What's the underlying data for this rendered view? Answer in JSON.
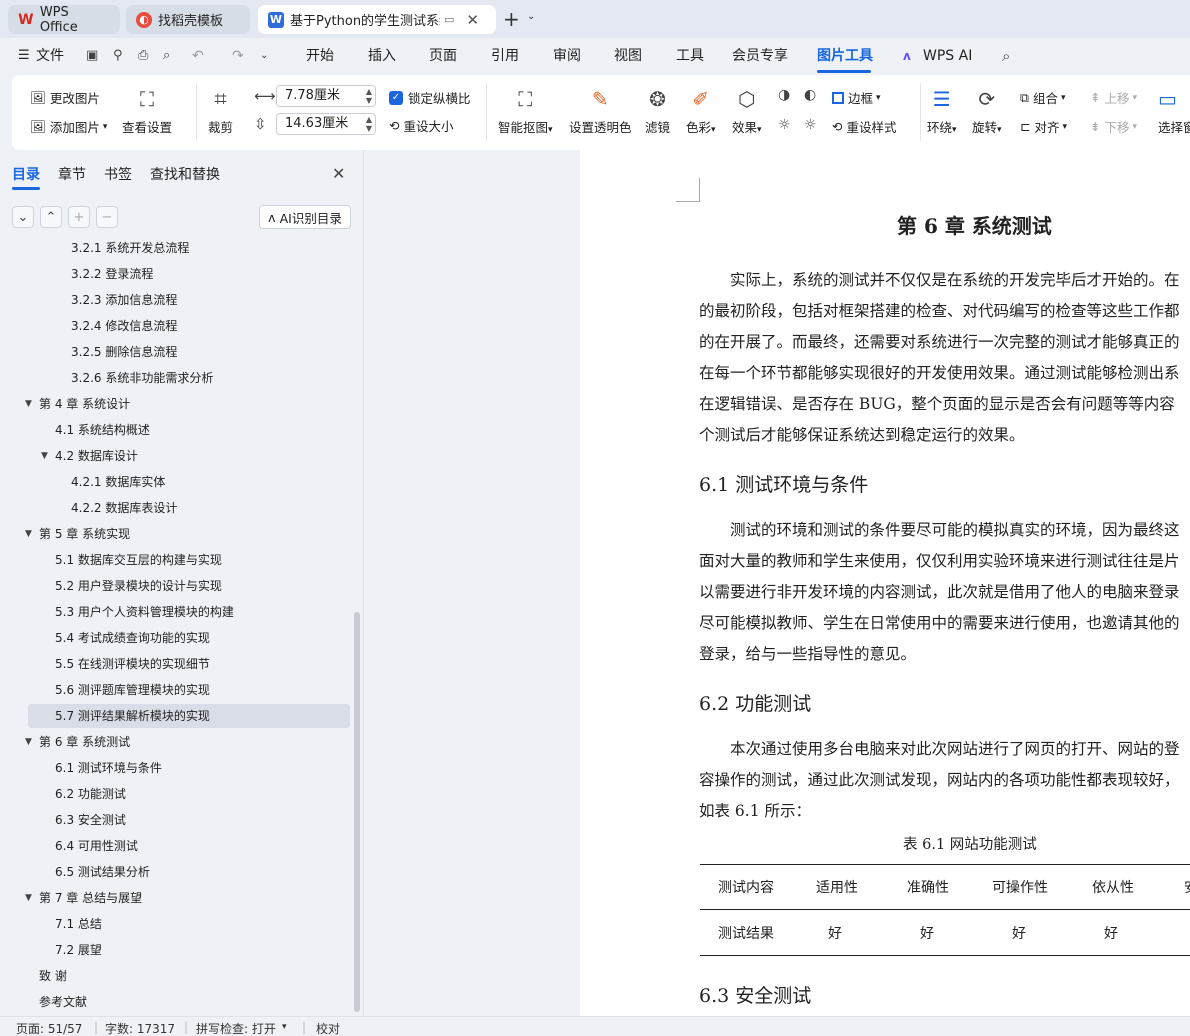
{
  "tabs": [
    {
      "label": "WPS Office",
      "icon": "wps-logo-icon"
    },
    {
      "label": "找稻壳模板",
      "icon": "docer-icon"
    },
    {
      "label": "基于Python的学生测试系统",
      "icon": "writer-doc-icon"
    }
  ],
  "menu": {
    "file": "文件",
    "items": [
      "开始",
      "插入",
      "页面",
      "引用",
      "审阅",
      "视图",
      "工具",
      "会员专享",
      "图片工具",
      "WPS AI"
    ],
    "active": "图片工具"
  },
  "ribbon": {
    "change_picture": "更改图片",
    "add_picture": "添加图片",
    "view_settings": "查看设置",
    "crop": "裁剪",
    "width": "7.78厘米",
    "height": "14.63厘米",
    "lock_ratio": "锁定纵横比",
    "reset_size": "重设大小",
    "smart_cutout": "智能抠图",
    "set_transparent": "设置透明色",
    "filter": "滤镜",
    "color": "色彩",
    "effects": "效果",
    "border": "边框",
    "reset_style": "重设样式",
    "wrap": "环绕",
    "rotate": "旋转",
    "group": "组合",
    "align": "对齐",
    "bring_forward": "上移",
    "send_backward": "下移",
    "select_pane": "选择窗"
  },
  "sidebar": {
    "tabs": [
      "目录",
      "章节",
      "书签",
      "查找和替换"
    ],
    "ai_toc": "AI识别目录",
    "toc": [
      {
        "text": "3.2.1  系统开发总流程",
        "level": 3
      },
      {
        "text": "3.2.2  登录流程",
        "level": 3
      },
      {
        "text": "3.2.3  添加信息流程",
        "level": 3
      },
      {
        "text": "3.2.4  修改信息流程",
        "level": 3
      },
      {
        "text": "3.2.5  删除信息流程",
        "level": 3
      },
      {
        "text": "3.2.6 系统非功能需求分析",
        "level": 3
      },
      {
        "text": "第 4 章  系统设计",
        "level": 1,
        "expanded": true
      },
      {
        "text": "4.1  系统结构概述",
        "level": 2
      },
      {
        "text": "4.2  数据库设计",
        "level": 2,
        "expanded": true
      },
      {
        "text": "4.2.1  数据库实体",
        "level": 3
      },
      {
        "text": "4.2.2  数据库表设计",
        "level": 3
      },
      {
        "text": "第 5 章  系统实现",
        "level": 1,
        "expanded": true
      },
      {
        "text": "5.1  数据库交互层的构建与实现",
        "level": 2
      },
      {
        "text": "5.2  用户登录模块的设计与实现",
        "level": 2
      },
      {
        "text": "5.3  用户个人资料管理模块的构建",
        "level": 2
      },
      {
        "text": "5.4  考试成绩查询功能的实现",
        "level": 2
      },
      {
        "text": "5.5  在线测评模块的实现细节",
        "level": 2
      },
      {
        "text": "5.6  测评题库管理模块的实现",
        "level": 2
      },
      {
        "text": "5.7  测评结果解析模块的实现",
        "level": 2,
        "selected": true
      },
      {
        "text": "第 6 章  系统测试",
        "level": 1,
        "expanded": true
      },
      {
        "text": "6.1 测试环境与条件",
        "level": 2
      },
      {
        "text": "6.2 功能测试",
        "level": 2
      },
      {
        "text": "6.3 安全测试",
        "level": 2
      },
      {
        "text": "6.4 可用性测试",
        "level": 2
      },
      {
        "text": "6.5 测试结果分析",
        "level": 2
      },
      {
        "text": "第 7 章  总结与展望",
        "level": 1,
        "expanded": true
      },
      {
        "text": "7.1  总结",
        "level": 2
      },
      {
        "text": "7.2 展望",
        "level": 2
      },
      {
        "text": "致    谢",
        "level": 1
      },
      {
        "text": "参考文献",
        "level": 1
      }
    ]
  },
  "document": {
    "chapter_title": "第 6 章  系统测试",
    "intro": [
      "实际上，系统的测试并不仅仅是在系统的开发完毕后才开始的。在",
      "的最初阶段，包括对框架搭建的检查、对代码编写的检查等这些工作都",
      "的在开展了。而最终，还需要对系统进行一次完整的测试才能够真正的",
      "在每一个环节都能够实现很好的开发使用效果。通过测试能够检测出系",
      "在逻辑错误、是否存在 BUG，整个页面的显示是否会有问题等等内容",
      "个测试后才能够保证系统达到稳定运行的效果。"
    ],
    "s61_title": "6.1 测试环境与条件",
    "s61": [
      "测试的环境和测试的条件要尽可能的模拟真实的环境，因为最终这",
      "面对大量的教师和学生来使用，仅仅利用实验环境来进行测试往往是片",
      "以需要进行非开发环境的内容测试，此次就是借用了他人的电脑来登录",
      "尽可能模拟教师、学生在日常使用中的需要来进行使用，也邀请其他的",
      "登录，给与一些指导性的意见。"
    ],
    "s62_title": "6.2 功能测试",
    "s62": [
      "本次通过使用多台电脑来对此次网站进行了网页的打开、网站的登",
      "容操作的测试，通过此次测试发现，网站内的各项功能性都表现较好，",
      "如表 6.1 所示："
    ],
    "table_caption": "表 6.1  网站功能测试",
    "table_header": [
      "测试内容",
      "适用性",
      "准确性",
      "可操作性",
      "依从性",
      "安"
    ],
    "table_row": [
      "测试结果",
      "好",
      "好",
      "好",
      "好",
      ""
    ],
    "s63_title": "6.3 安全测试"
  },
  "status": {
    "page": "页面: 51/57",
    "words": "字数: 17317",
    "spell": "拼写检查: 打开",
    "proof": "校对"
  }
}
